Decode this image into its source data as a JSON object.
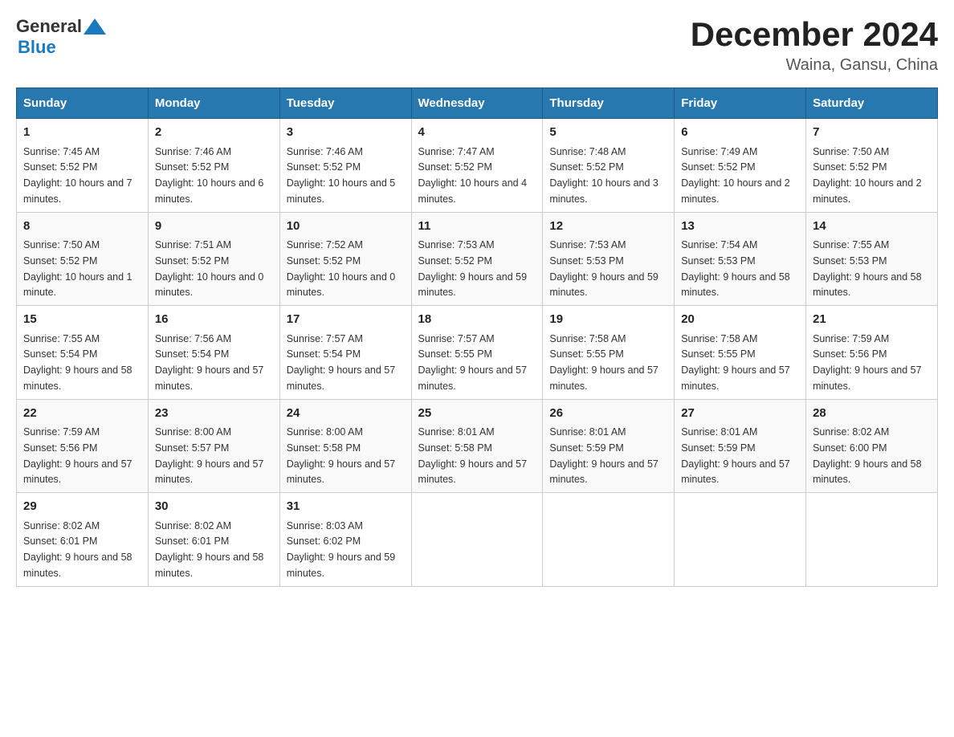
{
  "header": {
    "logo": {
      "general": "General",
      "blue": "Blue",
      "triangle": "▲"
    },
    "title": "December 2024",
    "location": "Waina, Gansu, China"
  },
  "calendar": {
    "days_of_week": [
      "Sunday",
      "Monday",
      "Tuesday",
      "Wednesday",
      "Thursday",
      "Friday",
      "Saturday"
    ],
    "weeks": [
      {
        "cells": [
          {
            "day": "1",
            "sunrise": "7:45 AM",
            "sunset": "5:52 PM",
            "daylight": "10 hours and 7 minutes."
          },
          {
            "day": "2",
            "sunrise": "7:46 AM",
            "sunset": "5:52 PM",
            "daylight": "10 hours and 6 minutes."
          },
          {
            "day": "3",
            "sunrise": "7:46 AM",
            "sunset": "5:52 PM",
            "daylight": "10 hours and 5 minutes."
          },
          {
            "day": "4",
            "sunrise": "7:47 AM",
            "sunset": "5:52 PM",
            "daylight": "10 hours and 4 minutes."
          },
          {
            "day": "5",
            "sunrise": "7:48 AM",
            "sunset": "5:52 PM",
            "daylight": "10 hours and 3 minutes."
          },
          {
            "day": "6",
            "sunrise": "7:49 AM",
            "sunset": "5:52 PM",
            "daylight": "10 hours and 2 minutes."
          },
          {
            "day": "7",
            "sunrise": "7:50 AM",
            "sunset": "5:52 PM",
            "daylight": "10 hours and 2 minutes."
          }
        ]
      },
      {
        "cells": [
          {
            "day": "8",
            "sunrise": "7:50 AM",
            "sunset": "5:52 PM",
            "daylight": "10 hours and 1 minute."
          },
          {
            "day": "9",
            "sunrise": "7:51 AM",
            "sunset": "5:52 PM",
            "daylight": "10 hours and 0 minutes."
          },
          {
            "day": "10",
            "sunrise": "7:52 AM",
            "sunset": "5:52 PM",
            "daylight": "10 hours and 0 minutes."
          },
          {
            "day": "11",
            "sunrise": "7:53 AM",
            "sunset": "5:52 PM",
            "daylight": "9 hours and 59 minutes."
          },
          {
            "day": "12",
            "sunrise": "7:53 AM",
            "sunset": "5:53 PM",
            "daylight": "9 hours and 59 minutes."
          },
          {
            "day": "13",
            "sunrise": "7:54 AM",
            "sunset": "5:53 PM",
            "daylight": "9 hours and 58 minutes."
          },
          {
            "day": "14",
            "sunrise": "7:55 AM",
            "sunset": "5:53 PM",
            "daylight": "9 hours and 58 minutes."
          }
        ]
      },
      {
        "cells": [
          {
            "day": "15",
            "sunrise": "7:55 AM",
            "sunset": "5:54 PM",
            "daylight": "9 hours and 58 minutes."
          },
          {
            "day": "16",
            "sunrise": "7:56 AM",
            "sunset": "5:54 PM",
            "daylight": "9 hours and 57 minutes."
          },
          {
            "day": "17",
            "sunrise": "7:57 AM",
            "sunset": "5:54 PM",
            "daylight": "9 hours and 57 minutes."
          },
          {
            "day": "18",
            "sunrise": "7:57 AM",
            "sunset": "5:55 PM",
            "daylight": "9 hours and 57 minutes."
          },
          {
            "day": "19",
            "sunrise": "7:58 AM",
            "sunset": "5:55 PM",
            "daylight": "9 hours and 57 minutes."
          },
          {
            "day": "20",
            "sunrise": "7:58 AM",
            "sunset": "5:55 PM",
            "daylight": "9 hours and 57 minutes."
          },
          {
            "day": "21",
            "sunrise": "7:59 AM",
            "sunset": "5:56 PM",
            "daylight": "9 hours and 57 minutes."
          }
        ]
      },
      {
        "cells": [
          {
            "day": "22",
            "sunrise": "7:59 AM",
            "sunset": "5:56 PM",
            "daylight": "9 hours and 57 minutes."
          },
          {
            "day": "23",
            "sunrise": "8:00 AM",
            "sunset": "5:57 PM",
            "daylight": "9 hours and 57 minutes."
          },
          {
            "day": "24",
            "sunrise": "8:00 AM",
            "sunset": "5:58 PM",
            "daylight": "9 hours and 57 minutes."
          },
          {
            "day": "25",
            "sunrise": "8:01 AM",
            "sunset": "5:58 PM",
            "daylight": "9 hours and 57 minutes."
          },
          {
            "day": "26",
            "sunrise": "8:01 AM",
            "sunset": "5:59 PM",
            "daylight": "9 hours and 57 minutes."
          },
          {
            "day": "27",
            "sunrise": "8:01 AM",
            "sunset": "5:59 PM",
            "daylight": "9 hours and 57 minutes."
          },
          {
            "day": "28",
            "sunrise": "8:02 AM",
            "sunset": "6:00 PM",
            "daylight": "9 hours and 58 minutes."
          }
        ]
      },
      {
        "cells": [
          {
            "day": "29",
            "sunrise": "8:02 AM",
            "sunset": "6:01 PM",
            "daylight": "9 hours and 58 minutes."
          },
          {
            "day": "30",
            "sunrise": "8:02 AM",
            "sunset": "6:01 PM",
            "daylight": "9 hours and 58 minutes."
          },
          {
            "day": "31",
            "sunrise": "8:03 AM",
            "sunset": "6:02 PM",
            "daylight": "9 hours and 59 minutes."
          },
          null,
          null,
          null,
          null
        ]
      }
    ],
    "labels": {
      "sunrise": "Sunrise:",
      "sunset": "Sunset:",
      "daylight": "Daylight:"
    }
  }
}
